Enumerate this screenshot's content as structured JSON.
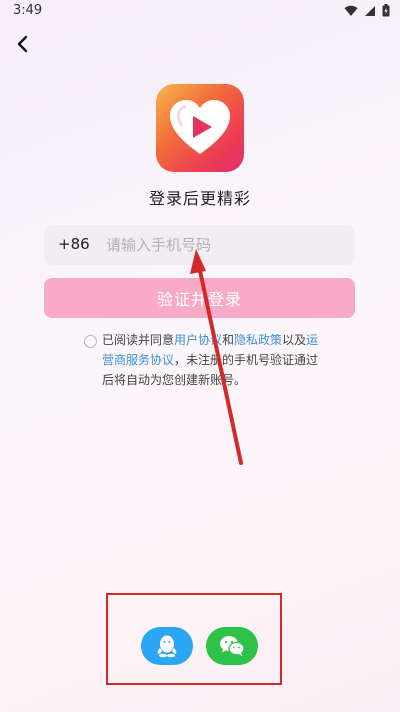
{
  "status_bar": {
    "time": "3:49"
  },
  "app": {
    "tagline": "登录后更精彩"
  },
  "login": {
    "country_code": "+86",
    "phone_placeholder": "请输入手机号码",
    "submit_label": "验证并登录"
  },
  "agreement": {
    "prefix": "已阅读并同意",
    "user_agreement": "用户协议",
    "and": "和",
    "privacy_policy": "隐私政策",
    "and2": "以及",
    "operator_agreement": "运营商服务协议",
    "suffix": "，未注册的手机号验证通过后将自动为您创建新账号。"
  },
  "social": {
    "qq_icon": "qq-penguin-icon",
    "wechat_icon": "wechat-icon"
  },
  "colors": {
    "brand_pink": "#f8aac6",
    "link_blue": "#3d8fd8",
    "qq_blue": "#2ba6f2",
    "wechat_green": "#2ec24a",
    "annotation_red": "#d22a2a"
  }
}
